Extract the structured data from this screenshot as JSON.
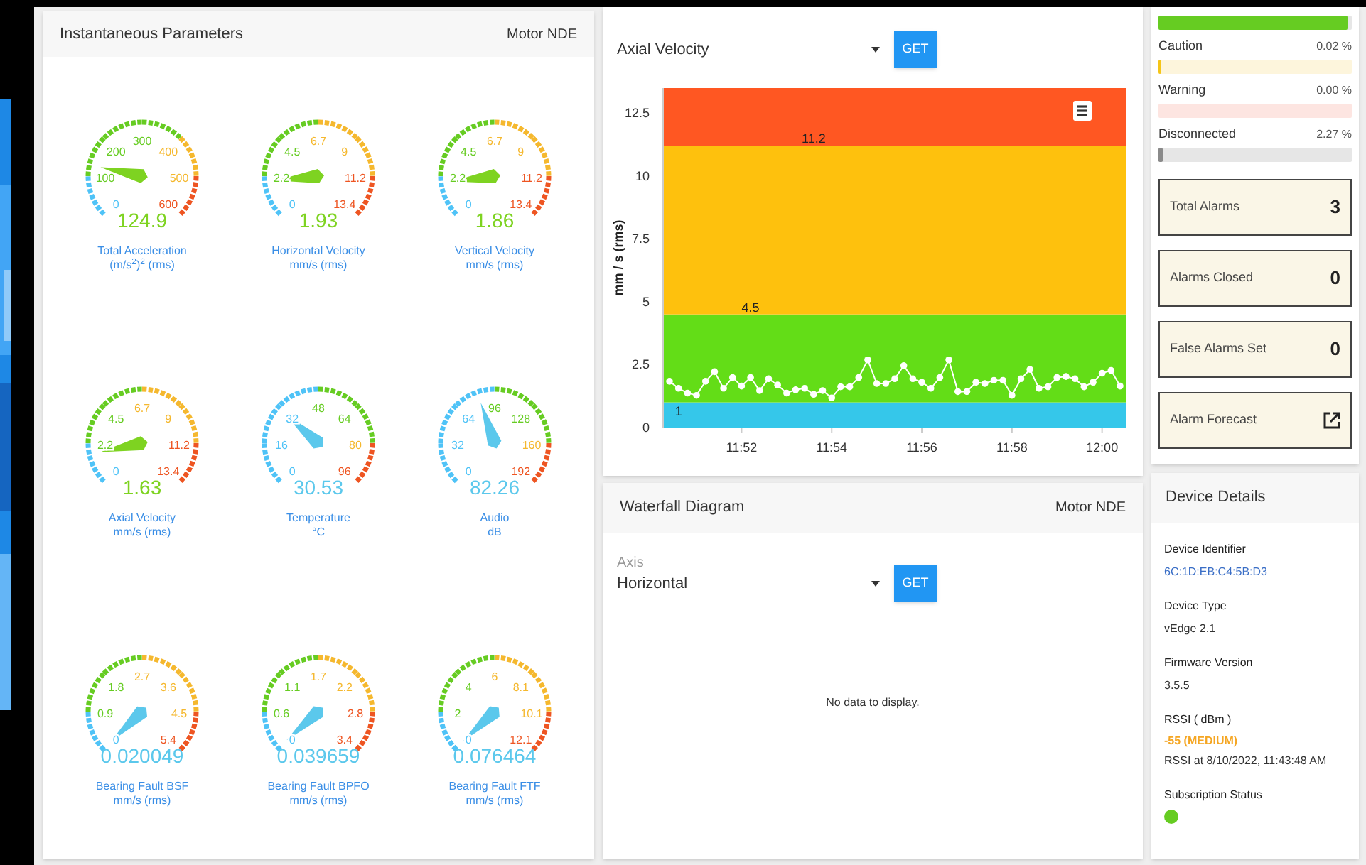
{
  "instantaneous": {
    "title": "Instantaneous Parameters",
    "asset": "Motor NDE",
    "gauges": [
      {
        "value": "124.9",
        "title": "Total Acceleration",
        "unit": "(m/s$^{2}$)$^{2}$ (rms)",
        "color": "#7ed321",
        "ticks": [
          {
            "label": "0",
            "color": "#4fc3f7"
          },
          {
            "label": "100",
            "color": "#66cc22"
          },
          {
            "label": "200",
            "color": "#66cc22"
          },
          {
            "label": "300",
            "color": "#66cc22"
          },
          {
            "label": "400",
            "color": "#f5b82e"
          },
          {
            "label": "500",
            "color": "#f5b82e"
          },
          {
            "label": "600",
            "color": "#ee5522"
          }
        ]
      },
      {
        "value": "1.93",
        "title": "Horizontal Velocity",
        "unit": "mm/s (rms)",
        "color": "#7ed321",
        "ticks": [
          {
            "label": "0",
            "color": "#4fc3f7"
          },
          {
            "label": "2.2",
            "color": "#66cc22"
          },
          {
            "label": "4.5",
            "color": "#66cc22"
          },
          {
            "label": "6.7",
            "color": "#f5b82e"
          },
          {
            "label": "9",
            "color": "#f5b82e"
          },
          {
            "label": "11.2",
            "color": "#ee5522"
          },
          {
            "label": "13.4",
            "color": "#ee5522"
          }
        ]
      },
      {
        "value": "1.86",
        "title": "Vertical Velocity",
        "unit": "mm/s (rms)",
        "color": "#7ed321",
        "ticks": [
          {
            "label": "0",
            "color": "#4fc3f7"
          },
          {
            "label": "2.2",
            "color": "#66cc22"
          },
          {
            "label": "4.5",
            "color": "#66cc22"
          },
          {
            "label": "6.7",
            "color": "#f5b82e"
          },
          {
            "label": "9",
            "color": "#f5b82e"
          },
          {
            "label": "11.2",
            "color": "#ee5522"
          },
          {
            "label": "13.4",
            "color": "#ee5522"
          }
        ]
      },
      {
        "value": "1.63",
        "title": "Axial Velocity",
        "unit": "mm/s (rms)",
        "color": "#7ed321",
        "ticks": [
          {
            "label": "0",
            "color": "#4fc3f7"
          },
          {
            "label": "2.2",
            "color": "#66cc22"
          },
          {
            "label": "4.5",
            "color": "#66cc22"
          },
          {
            "label": "6.7",
            "color": "#f5b82e"
          },
          {
            "label": "9",
            "color": "#f5b82e"
          },
          {
            "label": "11.2",
            "color": "#ee5522"
          },
          {
            "label": "13.4",
            "color": "#ee5522"
          }
        ]
      },
      {
        "value": "30.53",
        "title": "Temperature",
        "unit": "°C",
        "color": "#5bc8ec",
        "ticks": [
          {
            "label": "0",
            "color": "#4fc3f7"
          },
          {
            "label": "16",
            "color": "#4fc3f7"
          },
          {
            "label": "32",
            "color": "#4fc3f7"
          },
          {
            "label": "48",
            "color": "#66cc22"
          },
          {
            "label": "64",
            "color": "#66cc22"
          },
          {
            "label": "80",
            "color": "#f5b82e"
          },
          {
            "label": "96",
            "color": "#ee5522"
          }
        ]
      },
      {
        "value": "82.26",
        "title": "Audio",
        "unit": "dB",
        "color": "#5bc8ec",
        "ticks": [
          {
            "label": "0",
            "color": "#4fc3f7"
          },
          {
            "label": "32",
            "color": "#4fc3f7"
          },
          {
            "label": "64",
            "color": "#4fc3f7"
          },
          {
            "label": "96",
            "color": "#66cc22"
          },
          {
            "label": "128",
            "color": "#66cc22"
          },
          {
            "label": "160",
            "color": "#f5b82e"
          },
          {
            "label": "192",
            "color": "#ee5522"
          }
        ]
      },
      {
        "value": "0.020049",
        "title": "Bearing Fault BSF",
        "unit": "mm/s (rms)",
        "color": "#5bc8ec",
        "ticks": [
          {
            "label": "0",
            "color": "#4fc3f7"
          },
          {
            "label": "0.9",
            "color": "#66cc22"
          },
          {
            "label": "1.8",
            "color": "#66cc22"
          },
          {
            "label": "2.7",
            "color": "#f5b82e"
          },
          {
            "label": "3.6",
            "color": "#f5b82e"
          },
          {
            "label": "4.5",
            "color": "#f5b82e"
          },
          {
            "label": "5.4",
            "color": "#ee5522"
          }
        ]
      },
      {
        "value": "0.039659",
        "title": "Bearing Fault BPFO",
        "unit": "mm/s (rms)",
        "color": "#5bc8ec",
        "ticks": [
          {
            "label": "0",
            "color": "#4fc3f7"
          },
          {
            "label": "0.6",
            "color": "#66cc22"
          },
          {
            "label": "1.1",
            "color": "#66cc22"
          },
          {
            "label": "1.7",
            "color": "#f5b82e"
          },
          {
            "label": "2.2",
            "color": "#f5b82e"
          },
          {
            "label": "2.8",
            "color": "#ee5522"
          },
          {
            "label": "3.4",
            "color": "#ee5522"
          }
        ]
      },
      {
        "value": "0.076464",
        "title": "Bearing Fault FTF",
        "unit": "mm/s (rms)",
        "color": "#5bc8ec",
        "ticks": [
          {
            "label": "0",
            "color": "#4fc3f7"
          },
          {
            "label": "2",
            "color": "#66cc22"
          },
          {
            "label": "4",
            "color": "#66cc22"
          },
          {
            "label": "6",
            "color": "#f5b82e"
          },
          {
            "label": "8.1",
            "color": "#f5b82e"
          },
          {
            "label": "10.1",
            "color": "#f5b82e"
          },
          {
            "label": "12.1",
            "color": "#ee5522"
          }
        ]
      }
    ]
  },
  "trend": {
    "select": {
      "value": "Axial Velocity"
    },
    "button": "GET",
    "chart_data": {
      "type": "line",
      "ylabel": "mm / s (rms)",
      "ylim": [
        0,
        13.5
      ],
      "yticks": [
        0,
        2.5,
        5,
        7.5,
        10,
        12.5
      ],
      "categories": [
        null,
        null,
        null,
        null,
        null,
        null,
        null,
        null,
        "11:52",
        null,
        null,
        null,
        null,
        null,
        null,
        null,
        null,
        null,
        "11:54",
        null,
        null,
        null,
        null,
        null,
        null,
        null,
        null,
        null,
        "11:56",
        null,
        null,
        null,
        null,
        null,
        null,
        null,
        null,
        null,
        "11:58",
        null,
        null,
        null,
        null,
        null,
        null,
        null,
        null,
        null,
        "12:00",
        null,
        null
      ],
      "series": [
        {
          "color": "#ffffff",
          "marker": "circle",
          "values": [
            1.84,
            1.56,
            1.37,
            1.28,
            1.84,
            2.22,
            1.56,
            1.99,
            1.65,
            1.99,
            1.47,
            1.94,
            1.69,
            1.37,
            1.5,
            1.56,
            1.32,
            1.47,
            1.18,
            1.62,
            1.62,
            1.99,
            2.69,
            1.75,
            1.75,
            1.94,
            2.46,
            1.94,
            1.8,
            1.56,
            1.99,
            2.69,
            1.43,
            1.43,
            1.8,
            1.75,
            1.88,
            1.88,
            1.28,
            1.94,
            2.31,
            1.56,
            1.62,
            1.99,
            2.03,
            1.94,
            1.62,
            1.8,
            2.16,
            2.27,
            1.65
          ]
        }
      ],
      "bands": [
        {
          "axis": "y",
          "from": 0,
          "to": 1,
          "color": "#35c7ea"
        },
        {
          "axis": "y",
          "from": 1,
          "to": 4.5,
          "color": "#63dd17"
        },
        {
          "axis": "y",
          "from": 4.5,
          "to": 11.2,
          "color": "#fec10d"
        },
        {
          "axis": "y",
          "from": 11.2,
          "to": 13.5,
          "color": "#ff5722"
        }
      ],
      "annotations": [
        "1",
        "4.5",
        "11.2"
      ]
    }
  },
  "waterfall": {
    "title": "Waterfall Diagram",
    "asset": "Motor NDE",
    "axis": {
      "label": "Axis",
      "value": "Horizontal"
    },
    "button": "GET",
    "empty": "No data to display."
  },
  "statuses": [
    {
      "level": 0.977,
      "color": "#66cc22"
    },
    {
      "label": "Caution",
      "reading": "0.02 %",
      "level": 0.0002,
      "color": "#f5c518"
    },
    {
      "label": "Warning",
      "reading": "0.00 %"
    },
    {
      "label": "Disconnected",
      "reading": "2.27 %",
      "level": 0.0227,
      "color": "#8a8a8a"
    }
  ],
  "alarm_tiles": [
    {
      "kind": "count",
      "label": "Total Alarms",
      "value": "3"
    },
    {
      "kind": "count",
      "label": "Alarms Closed",
      "value": "0"
    },
    {
      "kind": "count",
      "label": "False Alarms Set",
      "value": "0"
    },
    {
      "kind": "link",
      "label": "Alarm Forecast"
    }
  ],
  "device": {
    "title": "Device Details",
    "fields": [
      {
        "kind": "link",
        "label": "Device Identifier",
        "value": "6C:1D:EB:C4:5B:D3"
      },
      {
        "kind": "text",
        "label": "Device Type",
        "value": "vEdge 2.1"
      },
      {
        "kind": "text",
        "label": "Firmware Version",
        "value": "3.5.5"
      },
      {
        "kind": "signal",
        "label": "RSSI ( dBm )",
        "value": "-55 (MEDIUM)",
        "note": "RSSI at 8/10/2022, 11:43:48 AM"
      },
      {
        "kind": "status",
        "label": "Subscription Status",
        "color": "#66cc22"
      }
    ]
  }
}
